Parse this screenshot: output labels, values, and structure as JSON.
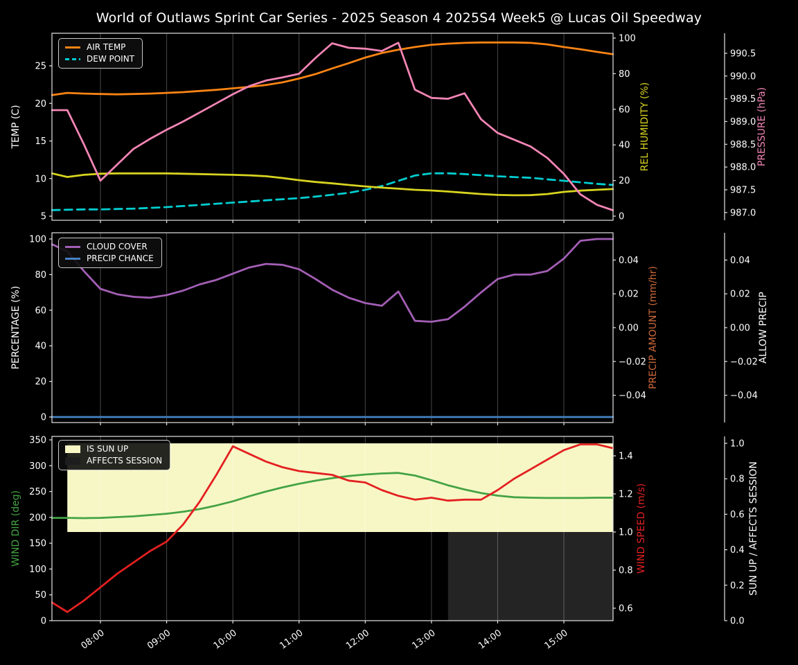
{
  "title": "World of Outlaws Sprint Car Series - 2025 Season 4 2025S4 Week5 @ Lucas Oil Speedway",
  "colors": {
    "background": "#000000",
    "text": "#ffffff",
    "spine": "#e6e6e6",
    "grid": "rgba(255,255,255,0.28)",
    "air_temp": "#fb8414",
    "dew_point": "#00ced1",
    "rel_humidity": "#d8d420",
    "pressure": "#f385b4",
    "cloud_cover": "#a35fb5",
    "precip_chance": "#4682c4",
    "precip_amount": "#cd6839",
    "wind_dir": "#44a344",
    "wind_speed": "#e32020",
    "sun_up_fill": "#f7f7c6",
    "affects_session_fill": "#242424"
  },
  "x_axis": {
    "tick_labels": [
      "08:00",
      "09:00",
      "10:00",
      "11:00",
      "12:00",
      "13:00",
      "14:00",
      "15:00"
    ],
    "tick_hours": [
      8,
      9,
      10,
      11,
      12,
      13,
      14,
      15
    ],
    "range_hours": [
      7.2675,
      15.7428
    ]
  },
  "chart_data": {
    "type": "line",
    "x_hours": [
      7.27,
      7.5,
      7.75,
      8.0,
      8.25,
      8.5,
      8.75,
      9.0,
      9.25,
      9.5,
      9.75,
      10.0,
      10.25,
      10.5,
      10.75,
      11.0,
      11.25,
      11.5,
      11.75,
      12.0,
      12.25,
      12.5,
      12.75,
      13.0,
      13.25,
      13.5,
      13.75,
      14.0,
      14.25,
      14.5,
      14.75,
      15.0,
      15.25,
      15.5,
      15.74
    ],
    "panels": [
      {
        "name": "temperature-humidity-pressure",
        "axes": {
          "left": {
            "label": "TEMP (C)",
            "color": "#ffffff",
            "range": [
              4.45,
              29.33
            ],
            "ticks": [
              {
                "v": 5,
                "label": "5"
              },
              {
                "v": 10,
                "label": "10"
              },
              {
                "v": 15,
                "label": "15"
              },
              {
                "v": 20,
                "label": "20"
              },
              {
                "v": 25,
                "label": "25"
              }
            ]
          },
          "right_inner": {
            "label": "REL HUMIDITY (%)",
            "color": "#d8d420",
            "range": [
              -2.33,
              102.7
            ],
            "ticks": [
              {
                "v": 0,
                "label": "0"
              },
              {
                "v": 20,
                "label": "20"
              },
              {
                "v": 40,
                "label": "40"
              },
              {
                "v": 60,
                "label": "60"
              },
              {
                "v": 80,
                "label": "80"
              },
              {
                "v": 100,
                "label": "100"
              }
            ]
          },
          "right_outer": {
            "label": "PRESSURE (hPa)",
            "color": "#f385b4",
            "range": [
              986.83,
              990.94
            ],
            "ticks": [
              {
                "v": 987.0,
                "label": "987.0"
              },
              {
                "v": 987.5,
                "label": "987.5"
              },
              {
                "v": 988.0,
                "label": "988.0"
              },
              {
                "v": 988.5,
                "label": "988.5"
              },
              {
                "v": 989.0,
                "label": "989.0"
              },
              {
                "v": 989.5,
                "label": "989.5"
              },
              {
                "v": 990.0,
                "label": "990.0"
              },
              {
                "v": 990.5,
                "label": "990.5"
              }
            ]
          }
        },
        "series": [
          {
            "name": "AIR TEMP",
            "axis": "left",
            "color": "#fb8414",
            "dash": null,
            "values": [
              21.1,
              21.4,
              21.3,
              21.25,
              21.2,
              21.25,
              21.3,
              21.4,
              21.5,
              21.65,
              21.8,
              22.0,
              22.2,
              22.45,
              22.8,
              23.3,
              23.9,
              24.65,
              25.35,
              26.1,
              26.7,
              27.15,
              27.5,
              27.8,
              27.95,
              28.05,
              28.1,
              28.1,
              28.1,
              28.05,
              27.85,
              27.5,
              27.2,
              26.85,
              26.55
            ]
          },
          {
            "name": "DEW POINT",
            "axis": "left",
            "color": "#00ced1",
            "dash": "11 7",
            "values": [
              5.8,
              5.85,
              5.9,
              5.9,
              5.95,
              6.0,
              6.1,
              6.2,
              6.35,
              6.5,
              6.65,
              6.8,
              6.95,
              7.1,
              7.25,
              7.4,
              7.6,
              7.85,
              8.1,
              8.5,
              9.0,
              9.7,
              10.4,
              10.7,
              10.7,
              10.6,
              10.45,
              10.3,
              10.2,
              10.1,
              9.9,
              9.7,
              9.5,
              9.3,
              9.15
            ]
          },
          {
            "name": "REL HUMIDITY",
            "axis": "right_inner",
            "color": "#d8d420",
            "dash": null,
            "values": [
              24,
              22,
              23.2,
              23.8,
              24,
              24,
              24,
              24,
              23.8,
              23.6,
              23.4,
              23.2,
              22.9,
              22.4,
              21.4,
              20.2,
              19.2,
              18.4,
              17.5,
              16.7,
              16.0,
              15.4,
              14.8,
              14.4,
              13.8,
              13.1,
              12.4,
              11.9,
              11.7,
              11.8,
              12.4,
              13.6,
              14.3,
              14.8,
              15.2
            ]
          },
          {
            "name": "PRESSURE",
            "axis": "right_outer",
            "color": "#f385b4",
            "dash": null,
            "values": [
              989.25,
              989.25,
              988.5,
              987.7,
              988.05,
              988.4,
              988.62,
              988.82,
              989.0,
              989.2,
              989.4,
              989.6,
              989.78,
              989.9,
              989.97,
              990.05,
              990.4,
              990.72,
              990.62,
              990.6,
              990.55,
              990.73,
              989.7,
              989.52,
              989.5,
              989.62,
              989.05,
              988.75,
              988.6,
              988.45,
              988.2,
              987.85,
              987.4,
              987.17,
              987.05
            ]
          }
        ],
        "legend": [
          {
            "label": "AIR TEMP",
            "swatch": "line",
            "color": "#fb8414"
          },
          {
            "label": "DEW POINT",
            "swatch": "dashed",
            "color": "#00ced1"
          }
        ]
      },
      {
        "name": "cloud-precip",
        "axes": {
          "left": {
            "label": "PERCENTAGE (%)",
            "color": "#ffffff",
            "range": [
              -3.11,
              103.5
            ],
            "ticks": [
              {
                "v": 0,
                "label": "0"
              },
              {
                "v": 20,
                "label": "20"
              },
              {
                "v": 40,
                "label": "40"
              },
              {
                "v": 60,
                "label": "60"
              },
              {
                "v": 80,
                "label": "80"
              },
              {
                "v": 100,
                "label": "100"
              }
            ]
          },
          "right_inner": {
            "label": "PRECIP AMOUNT (mm/hr)",
            "color": "#cd6839",
            "range": [
              -0.05615,
              0.05615
            ],
            "ticks": [
              {
                "v": -0.04,
                "label": "−0.04"
              },
              {
                "v": -0.02,
                "label": "−0.02"
              },
              {
                "v": 0,
                "label": "0.00"
              },
              {
                "v": 0.02,
                "label": "0.02"
              },
              {
                "v": 0.04,
                "label": "0.04"
              }
            ]
          },
          "right_outer": {
            "label": "ALLOW PRECIP",
            "color": "#ffffff",
            "range": [
              -0.05615,
              0.05615
            ],
            "ticks": [
              {
                "v": -0.04,
                "label": "−0.04"
              },
              {
                "v": -0.02,
                "label": "−0.02"
              },
              {
                "v": 0,
                "label": "0.00"
              },
              {
                "v": 0.02,
                "label": "0.02"
              },
              {
                "v": 0.04,
                "label": "0.04"
              }
            ]
          }
        },
        "series": [
          {
            "name": "CLOUD COVER",
            "axis": "left",
            "color": "#a35fb5",
            "dash": null,
            "values": [
              97,
              93,
              82,
              72,
              69,
              67.5,
              67,
              68.5,
              71,
              74.5,
              77,
              80.5,
              84,
              86,
              85.5,
              83,
              77.5,
              71.5,
              67,
              64,
              62.5,
              70.5,
              54,
              53.5,
              55,
              62,
              70,
              77.5,
              80,
              80,
              82,
              89,
              99,
              100,
              100
            ]
          },
          {
            "name": "PRECIP CHANCE",
            "axis": "left",
            "color": "#4682c4",
            "dash": null,
            "values": [
              0,
              0,
              0,
              0,
              0,
              0,
              0,
              0,
              0,
              0,
              0,
              0,
              0,
              0,
              0,
              0,
              0,
              0,
              0,
              0,
              0,
              0,
              0,
              0,
              0,
              0,
              0,
              0,
              0,
              0,
              0,
              0,
              0,
              0,
              0
            ]
          }
        ],
        "legend": [
          {
            "label": "CLOUD COVER",
            "swatch": "line",
            "color": "#a35fb5"
          },
          {
            "label": "PRECIP CHANCE",
            "swatch": "line",
            "color": "#4682c4"
          }
        ]
      },
      {
        "name": "wind-sun",
        "axes": {
          "left": {
            "label": "WIND DIR (deg)",
            "color": "#44a344",
            "range": [
              0,
              356.7
            ],
            "ticks": [
              {
                "v": 0,
                "label": "0"
              },
              {
                "v": 50,
                "label": "50"
              },
              {
                "v": 100,
                "label": "100"
              },
              {
                "v": 150,
                "label": "150"
              },
              {
                "v": 200,
                "label": "200"
              },
              {
                "v": 250,
                "label": "250"
              },
              {
                "v": 300,
                "label": "300"
              },
              {
                "v": 350,
                "label": "350"
              }
            ]
          },
          "right_inner": {
            "label": "WIND SPEED (m/s)",
            "color": "#e32020",
            "range": [
              0.5346,
              1.502
            ],
            "ticks": [
              {
                "v": 0.6,
                "label": "0.6"
              },
              {
                "v": 0.8,
                "label": "0.8"
              },
              {
                "v": 1.0,
                "label": "1.0"
              },
              {
                "v": 1.2,
                "label": "1.2"
              },
              {
                "v": 1.4,
                "label": "1.4"
              }
            ]
          },
          "right_outer": {
            "label": "SUN UP / AFFECTS SESSION",
            "color": "#ffffff",
            "range": [
              0,
              1.039
            ],
            "ticks": [
              {
                "v": 0.0,
                "label": "0.0"
              },
              {
                "v": 0.2,
                "label": "0.2"
              },
              {
                "v": 0.4,
                "label": "0.4"
              },
              {
                "v": 0.6,
                "label": "0.6"
              },
              {
                "v": 0.8,
                "label": "0.8"
              },
              {
                "v": 1.0,
                "label": "1.0"
              }
            ]
          }
        },
        "fills": [
          {
            "name": "IS SUN UP",
            "axis": "right_outer",
            "color": "#f7f7c6",
            "from_hour": 7.5,
            "to_hour": 15.7428,
            "y_from": 0.5,
            "y_to": 1.0
          },
          {
            "name": "AFFECTS SESSION",
            "axis": "right_outer",
            "color": "#242424",
            "from_hour": 13.25,
            "to_hour": 15.7428,
            "y_from": 0.0,
            "y_to": 0.5
          }
        ],
        "series": [
          {
            "name": "WIND DIR",
            "axis": "left",
            "color": "#44a344",
            "dash": null,
            "values": [
              199,
              199,
              198.5,
              199,
              200.5,
              202,
              204.5,
              207,
              211,
              216,
              223,
              231,
              241,
              250,
              258,
              265,
              271,
              276,
              280,
              283,
              285,
              286,
              281,
              272,
              262,
              254,
              247,
              242,
              239,
              238,
              237.5,
              237.5,
              237.5,
              238,
              238
            ]
          },
          {
            "name": "WIND SPEED",
            "axis": "right_inner",
            "color": "#e32020",
            "dash": null,
            "values": [
              0.63,
              0.58,
              0.64,
              0.71,
              0.78,
              0.84,
              0.9,
              0.95,
              1.04,
              1.16,
              1.3,
              1.45,
              1.41,
              1.37,
              1.34,
              1.32,
              1.31,
              1.3,
              1.27,
              1.26,
              1.22,
              1.19,
              1.17,
              1.18,
              1.165,
              1.17,
              1.17,
              1.22,
              1.28,
              1.33,
              1.38,
              1.43,
              1.46,
              1.46,
              1.44
            ]
          }
        ],
        "legend": [
          {
            "label": "IS SUN UP",
            "swatch": "patch",
            "color": "#f7f7c6"
          },
          {
            "label": "AFFECTS SESSION",
            "swatch": "patch",
            "color": "#1d1d1d"
          }
        ]
      }
    ]
  }
}
